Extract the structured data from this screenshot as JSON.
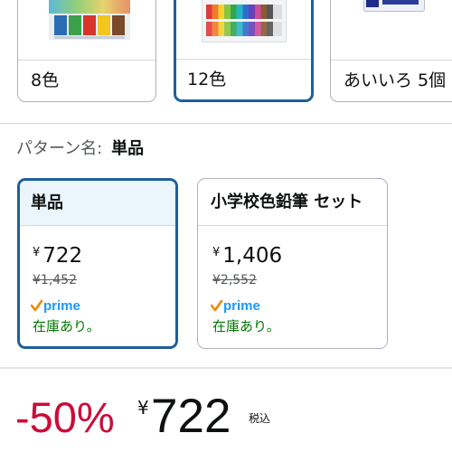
{
  "color_options": {
    "items": [
      {
        "label": "8色",
        "selected": false
      },
      {
        "label": "12色",
        "selected": true
      },
      {
        "label": "あいいろ 5個",
        "selected": false
      }
    ]
  },
  "pattern": {
    "key_label": "パターン名:",
    "selected_value": "単品",
    "options": [
      {
        "name": "単品",
        "selected": true,
        "yen_symbol": "¥",
        "price": "722",
        "list_price": "¥1,452",
        "prime_label": "prime",
        "stock": "在庫あり。"
      },
      {
        "name": "小学校色鉛筆 セット",
        "selected": false,
        "yen_symbol": "¥",
        "price": "1,406",
        "list_price": "¥2,552",
        "prime_label": "prime",
        "stock": "在庫あり。"
      }
    ]
  },
  "price_block": {
    "discount": "-50%",
    "yen_symbol": "¥",
    "amount": "722",
    "tax_note": "税込"
  },
  "colors": {
    "selected_border": "#1f5f9a",
    "selected_bg": "#eaf6fc",
    "discount_red": "#cc0c39",
    "stock_green": "#007600",
    "prime_blue": "#1a98ff",
    "prime_orange": "#f08804"
  }
}
